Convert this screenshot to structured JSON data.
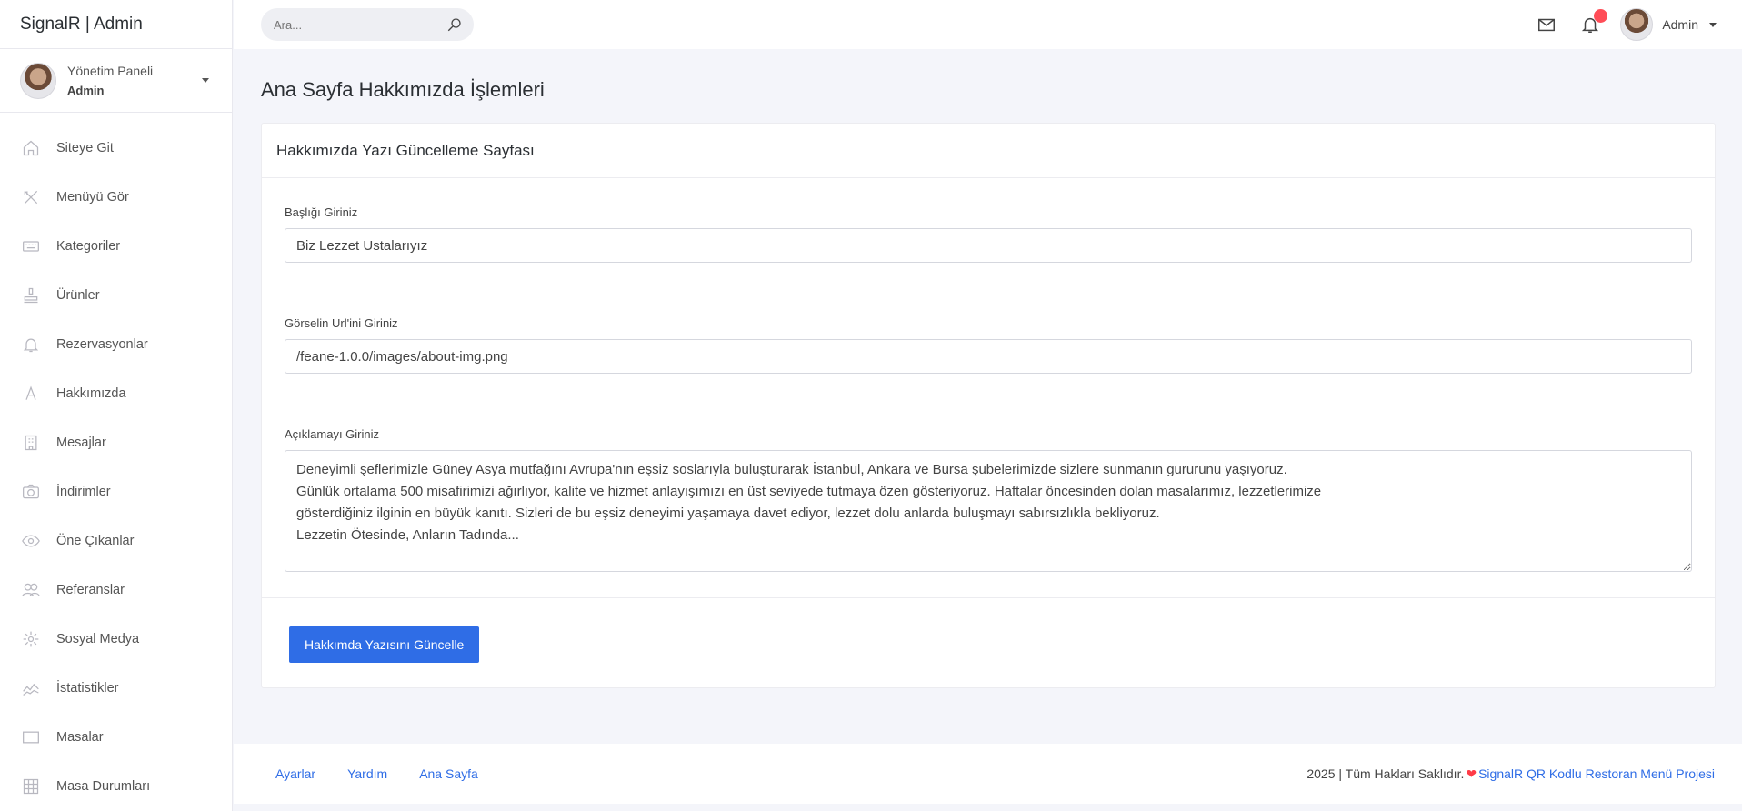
{
  "brand": "SignalR | Admin",
  "user": {
    "panel": "Yönetim Paneli",
    "role": "Admin"
  },
  "sidebar": {
    "items": [
      {
        "label": "Siteye Git",
        "icon": "home-icon"
      },
      {
        "label": "Menüyü Gör",
        "icon": "utensils-icon"
      },
      {
        "label": "Kategoriler",
        "icon": "keyboard-icon"
      },
      {
        "label": "Ürünler",
        "icon": "stamp-icon"
      },
      {
        "label": "Rezervasyonlar",
        "icon": "bell-icon"
      },
      {
        "label": "Hakkımızda",
        "icon": "letter-a-icon"
      },
      {
        "label": "Mesajlar",
        "icon": "building-icon"
      },
      {
        "label": "İndirimler",
        "icon": "camera-icon"
      },
      {
        "label": "Öne Çıkanlar",
        "icon": "eye-icon"
      },
      {
        "label": "Referanslar",
        "icon": "users-icon"
      },
      {
        "label": "Sosyal Medya",
        "icon": "gear-icon"
      },
      {
        "label": "İstatistikler",
        "icon": "chart-line-icon"
      },
      {
        "label": "Masalar",
        "icon": "rectangle-icon"
      },
      {
        "label": "Masa Durumları",
        "icon": "grid-icon"
      }
    ]
  },
  "topbar": {
    "search_placeholder": "Ara...",
    "user_name": "Admin"
  },
  "page": {
    "title": "Ana Sayfa Hakkımızda İşlemleri",
    "card_title": "Hakkımızda Yazı Güncelleme Sayfası",
    "fields": {
      "title_label": "Başlığı Giriniz",
      "title_value": "Biz Lezzet Ustalarıyız",
      "image_label": "Görselin Url'ini Giriniz",
      "image_value": "/feane-1.0.0/images/about-img.png",
      "desc_label": "Açıklamayı Giriniz",
      "desc_value": "Deneyimli şeflerimizle Güney Asya mutfağını Avrupa'nın eşsiz soslarıyla buluşturarak İstanbul, Ankara ve Bursa şubelerimizde sizlere sunmanın gururunu yaşıyoruz.\nGünlük ortalama 500 misafirimizi ağırlıyor, kalite ve hizmet anlayışımızı en üst seviyede tutmaya özen gösteriyoruz. Haftalar öncesinden dolan masalarımız, lezzetlerimize\ngösterdiğiniz ilginin en büyük kanıtı. Sizleri de bu eşsiz deneyimi yaşamaya davet ediyor, lezzet dolu anlarda buluşmayı sabırsızlıkla bekliyoruz.\nLezzetin Ötesinde, Anların Tadında..."
    },
    "submit_label": "Hakkımda Yazısını Güncelle"
  },
  "footer": {
    "links": [
      "Ayarlar",
      "Yardım",
      "Ana Sayfa"
    ],
    "copyright": "2025 | Tüm Hakları Saklıdır.",
    "project_link": "SignalR QR Kodlu Restoran Menü Projesi"
  },
  "colors": {
    "primary": "#2f6de6",
    "notification": "#ff4d57",
    "background": "#f4f5fa"
  }
}
